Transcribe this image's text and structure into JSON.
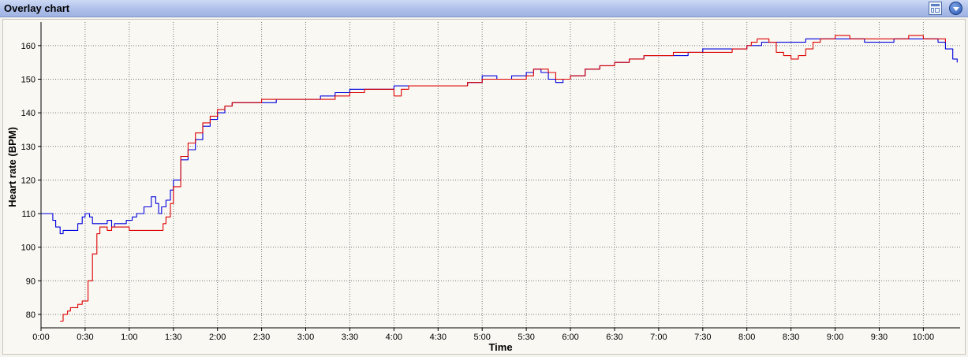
{
  "window": {
    "title": "Overlay chart"
  },
  "chart_data": {
    "type": "line",
    "xlabel": "Time",
    "ylabel": "Heart rate (BPM)",
    "xlim": [
      0,
      625
    ],
    "ylim": [
      76,
      167
    ],
    "x_ticks": [
      {
        "v": 0,
        "label": "0:00"
      },
      {
        "v": 30,
        "label": "0:30"
      },
      {
        "v": 60,
        "label": "1:00"
      },
      {
        "v": 90,
        "label": "1:30"
      },
      {
        "v": 120,
        "label": "2:00"
      },
      {
        "v": 150,
        "label": "2:30"
      },
      {
        "v": 180,
        "label": "3:00"
      },
      {
        "v": 210,
        "label": "3:30"
      },
      {
        "v": 240,
        "label": "4:00"
      },
      {
        "v": 270,
        "label": "4:30"
      },
      {
        "v": 300,
        "label": "5:00"
      },
      {
        "v": 330,
        "label": "5:30"
      },
      {
        "v": 360,
        "label": "6:00"
      },
      {
        "v": 390,
        "label": "6:30"
      },
      {
        "v": 420,
        "label": "7:00"
      },
      {
        "v": 450,
        "label": "7:30"
      },
      {
        "v": 480,
        "label": "8:00"
      },
      {
        "v": 510,
        "label": "8:30"
      },
      {
        "v": 540,
        "label": "9:00"
      },
      {
        "v": 570,
        "label": "9:30"
      },
      {
        "v": 600,
        "label": "10:00"
      }
    ],
    "y_ticks": [
      {
        "v": 80,
        "label": "80"
      },
      {
        "v": 90,
        "label": "90"
      },
      {
        "v": 100,
        "label": "100"
      },
      {
        "v": 110,
        "label": "110"
      },
      {
        "v": 120,
        "label": "120"
      },
      {
        "v": 130,
        "label": "130"
      },
      {
        "v": 140,
        "label": "140"
      },
      {
        "v": 150,
        "label": "150"
      },
      {
        "v": 160,
        "label": "160"
      }
    ],
    "grid": true,
    "series": [
      {
        "color": "#0000dd",
        "x": [
          0,
          5,
          8,
          10,
          13,
          15,
          20,
          25,
          28,
          30,
          33,
          35,
          38,
          42,
          45,
          48,
          50,
          55,
          58,
          60,
          62,
          65,
          70,
          75,
          78,
          80,
          82,
          85,
          88,
          90,
          95,
          100,
          105,
          110,
          115,
          120,
          125,
          130,
          135,
          140,
          145,
          150,
          160,
          170,
          180,
          190,
          200,
          210,
          220,
          230,
          240,
          250,
          260,
          270,
          280,
          290,
          300,
          310,
          320,
          330,
          335,
          340,
          345,
          350,
          355,
          360,
          370,
          380,
          390,
          400,
          410,
          420,
          430,
          440,
          450,
          460,
          470,
          480,
          490,
          500,
          510,
          520,
          530,
          540,
          550,
          560,
          570,
          580,
          590,
          600,
          605,
          610,
          615,
          620,
          623
        ],
        "y": [
          110,
          110,
          108,
          106,
          104,
          105,
          105,
          107,
          109,
          110,
          109,
          107,
          107,
          107,
          108,
          106,
          107,
          107,
          108,
          108,
          109,
          110,
          112,
          115,
          113,
          110,
          112,
          114,
          117,
          120,
          126,
          129,
          132,
          136,
          138,
          140,
          142,
          143,
          143,
          143,
          143,
          143,
          144,
          144,
          144,
          145,
          146,
          147,
          147,
          147,
          148,
          148,
          148,
          148,
          148,
          149,
          151,
          150,
          151,
          152,
          153,
          152,
          150,
          149,
          150,
          151,
          153,
          154,
          155,
          156,
          157,
          157,
          157,
          158,
          159,
          159,
          159,
          160,
          161,
          161,
          161,
          162,
          162,
          162,
          162,
          161,
          161,
          162,
          162,
          162,
          162,
          161,
          159,
          156,
          155
        ]
      },
      {
        "color": "#dd0000",
        "x": [
          13,
          15,
          18,
          20,
          25,
          28,
          30,
          32,
          35,
          38,
          40,
          43,
          45,
          48,
          50,
          55,
          60,
          70,
          80,
          83,
          85,
          88,
          90,
          95,
          100,
          105,
          110,
          115,
          120,
          125,
          130,
          135,
          140,
          145,
          150,
          160,
          170,
          180,
          190,
          200,
          210,
          220,
          230,
          235,
          240,
          243,
          245,
          250,
          260,
          270,
          280,
          290,
          300,
          310,
          320,
          330,
          335,
          340,
          345,
          350,
          355,
          360,
          370,
          380,
          390,
          400,
          410,
          420,
          430,
          440,
          450,
          460,
          470,
          480,
          483,
          487,
          490,
          495,
          500,
          505,
          510,
          515,
          520,
          525,
          530,
          540,
          550,
          560,
          570,
          580,
          590,
          600,
          605,
          610,
          615
        ],
        "y": [
          78,
          80,
          81,
          82,
          83,
          84,
          84,
          90,
          98,
          104,
          106,
          106,
          105,
          106,
          106,
          106,
          105,
          105,
          105,
          107,
          109,
          113,
          118,
          127,
          131,
          134,
          137,
          139,
          141,
          142,
          143,
          143,
          143,
          143,
          144,
          144,
          144,
          144,
          144,
          145,
          146,
          147,
          147,
          147,
          145,
          145,
          147,
          148,
          148,
          148,
          148,
          149,
          150,
          150,
          150,
          151,
          153,
          153,
          152,
          150,
          150,
          151,
          153,
          154,
          155,
          156,
          157,
          157,
          158,
          158,
          158,
          158,
          159,
          160,
          161,
          162,
          162,
          161,
          158,
          157,
          156,
          157,
          159,
          161,
          162,
          163,
          162,
          162,
          162,
          162,
          163,
          162,
          162,
          162,
          161
        ]
      }
    ]
  }
}
